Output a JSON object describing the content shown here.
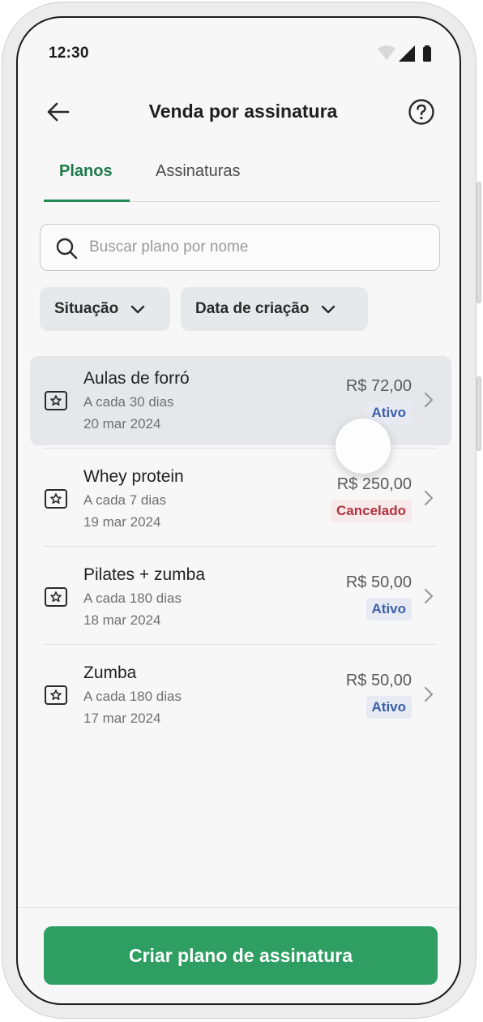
{
  "status_bar": {
    "time": "12:30"
  },
  "header": {
    "title": "Venda por assinatura"
  },
  "tabs": [
    {
      "label": "Planos",
      "active": true
    },
    {
      "label": "Assinaturas",
      "active": false
    }
  ],
  "search": {
    "placeholder": "Buscar plano por nome",
    "value": ""
  },
  "filters": [
    {
      "label": "Situação"
    },
    {
      "label": "Data de criação"
    }
  ],
  "plans": [
    {
      "name": "Aulas de forró",
      "frequency": "A cada 30 dias",
      "created": "20 mar 2024",
      "price": "R$ 72,00",
      "status": "Ativo",
      "status_color": "#3a5fa8"
    },
    {
      "name": "Whey protein",
      "frequency": "A cada 7 dias",
      "created": "19 mar 2024",
      "price": "R$ 250,00",
      "status": "Cancelado",
      "status_color": "#b0323c"
    },
    {
      "name": "Pilates + zumba",
      "frequency": "A cada 180 dias",
      "created": "18 mar 2024",
      "price": "R$ 50,00",
      "status": "Ativo",
      "status_color": "#3a5fa8"
    },
    {
      "name": "Zumba",
      "frequency": "A cada 180 dias",
      "created": "17 mar 2024",
      "price": "R$ 50,00",
      "status": "Ativo",
      "status_color": "#3a5fa8"
    }
  ],
  "actions": {
    "create_plan": "Criar plano de assinatura"
  },
  "colors": {
    "accent": "#2f9e63",
    "tab_active": "#1e7a4a"
  }
}
